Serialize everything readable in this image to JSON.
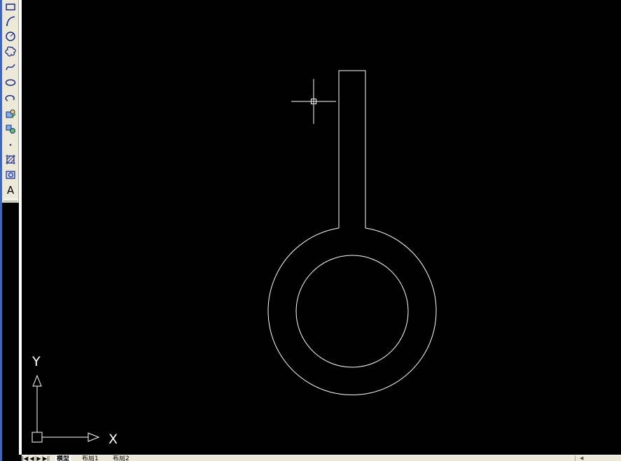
{
  "toolbar": {
    "tools": [
      {
        "icon": "rectangle-icon"
      },
      {
        "icon": "arc-icon"
      },
      {
        "icon": "circle-icon"
      },
      {
        "icon": "revision-cloud-icon"
      },
      {
        "icon": "spline-icon"
      },
      {
        "icon": "ellipse-icon"
      },
      {
        "icon": "ellipse-arc-icon"
      },
      {
        "icon": "insert-block-icon"
      },
      {
        "icon": "make-block-icon"
      },
      {
        "icon": "point-icon"
      },
      {
        "icon": "hatch-icon"
      },
      {
        "icon": "region-icon"
      },
      {
        "icon": "multiline-text-icon",
        "label": "A"
      }
    ]
  },
  "ucs": {
    "x_label": "X",
    "y_label": "Y"
  },
  "layout_tabs": {
    "nav": [
      "|◀",
      "◀",
      "▶",
      "▶|"
    ],
    "tabs": [
      "模型",
      "布局1",
      "布局2"
    ],
    "active": "模型"
  },
  "colors": {
    "canvas_background": "#000000",
    "drawing_lines": "#ffffff",
    "toolbar_background": "#ece9d8",
    "window_accent": "#3c66c6"
  }
}
